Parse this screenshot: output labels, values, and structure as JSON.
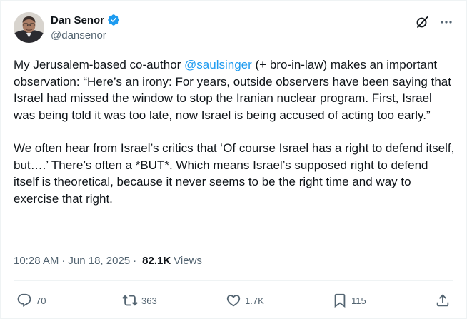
{
  "author": {
    "display_name": "Dan Senor",
    "handle": "@dansenor",
    "verified": true
  },
  "tweet": {
    "p1_before": "My Jerusalem-based co-author ",
    "p1_mention": "@saulsinger",
    "p1_after": " (+ bro-in-law) makes an important observation: “Here’s an irony: For years, outside observers have been saying that Israel had missed the window to stop the Iranian nuclear program. First, Israel was being told it was too late, now Israel is being accused of acting too early.”",
    "p2": "We often hear from Israel’s critics that ‘Of course Israel has a right to defend itself, but….’ There’s often a *BUT*. Which means Israel’s supposed right to defend itself is theoretical, because it never seems to be the right time and way to exercise that right."
  },
  "meta": {
    "time": "10:28 AM",
    "date": "Jun 18, 2025",
    "sep": "·",
    "views_count": "82.1K",
    "views_label": "Views"
  },
  "actions": {
    "replies": "70",
    "retweets": "363",
    "likes": "1.7K",
    "bookmarks": "115"
  },
  "icons": {
    "header": [
      "verified-badge-icon",
      "grok-icon",
      "more-icon"
    ],
    "actions": [
      "reply-icon",
      "retweet-icon",
      "like-icon",
      "bookmark-icon",
      "share-icon"
    ]
  },
  "colors": {
    "accent": "#1d9bf0",
    "text": "#0f1419",
    "secondary": "#536471"
  }
}
